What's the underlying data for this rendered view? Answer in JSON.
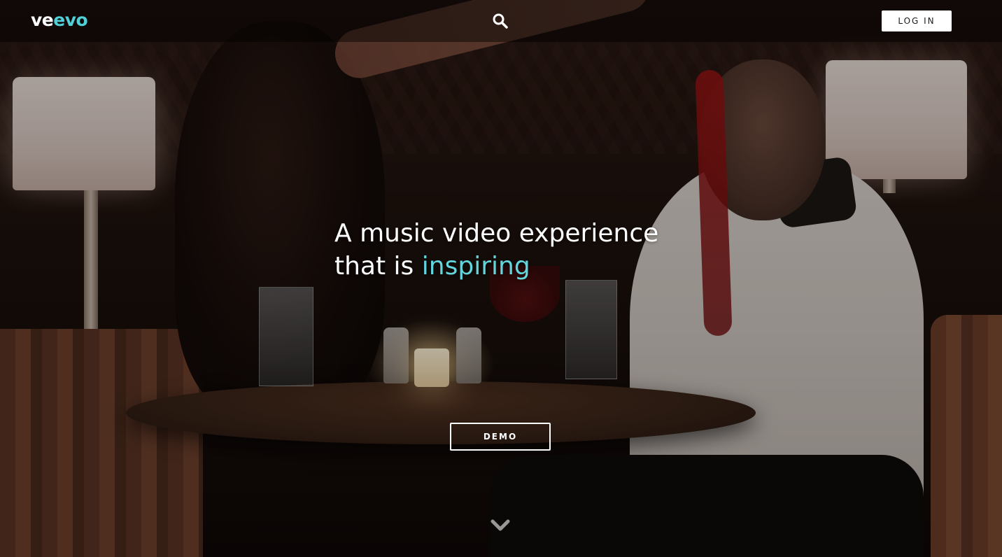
{
  "header": {
    "logo": {
      "part1": "ve",
      "part2": "evo",
      "accent_color": "#4fd0d8"
    },
    "search_icon": "search-icon",
    "login_label": "LOG IN"
  },
  "hero": {
    "line1": "A music video experience",
    "line2_prefix": "that is ",
    "line2_accent": "inspiring",
    "accent_color": "#63d5dc",
    "demo_label": "DEMO",
    "scroll_icon": "chevron-down-icon"
  },
  "background": {
    "description_icon": "hero-background-image"
  }
}
